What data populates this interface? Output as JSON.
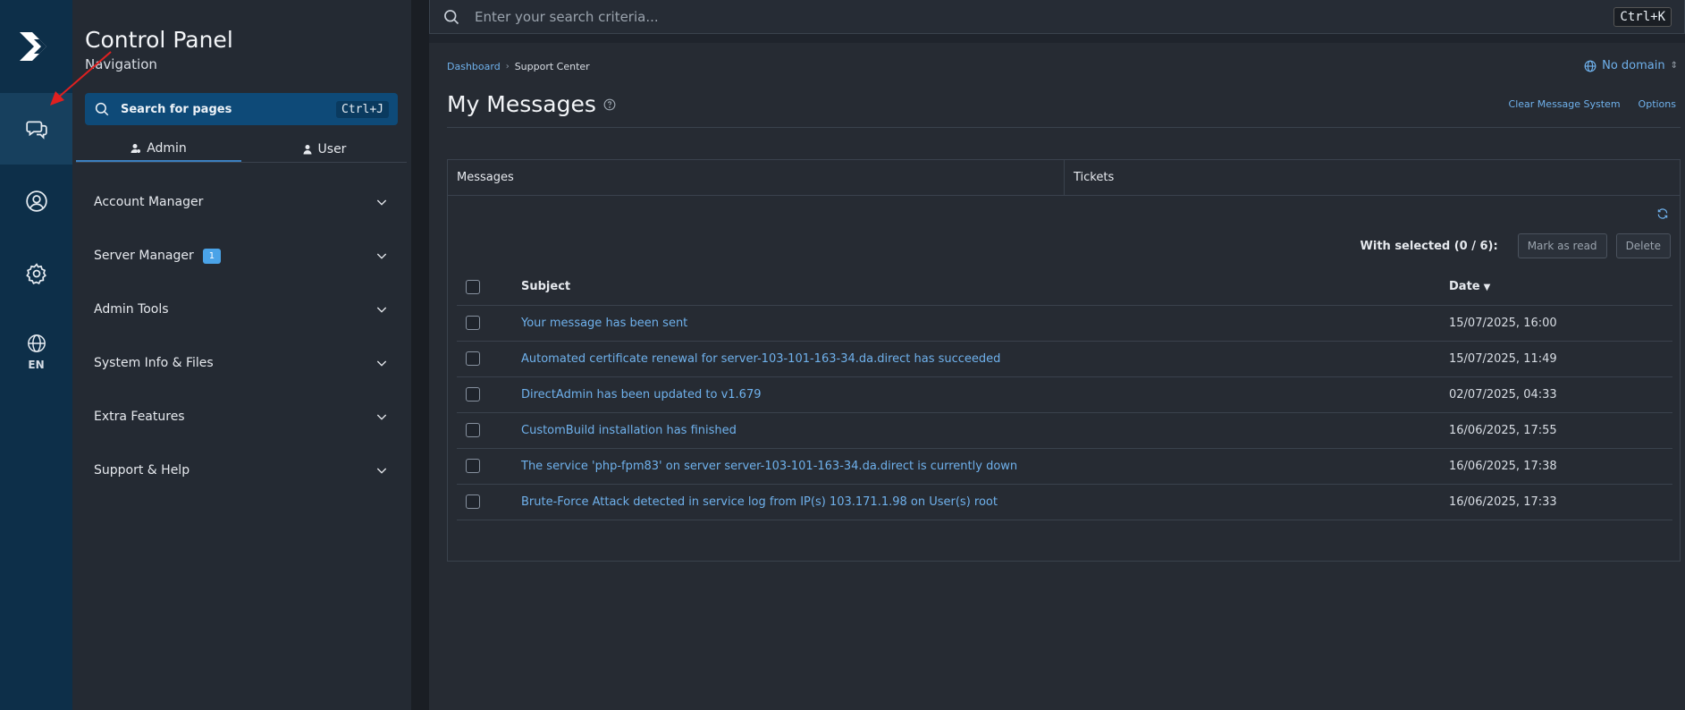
{
  "rail": {
    "lang": "EN"
  },
  "nav": {
    "title": "Control Panel",
    "subtitle": "Navigation",
    "search_label": "Search for pages",
    "search_shortcut": "Ctrl+J",
    "tabs": [
      {
        "label": "Admin"
      },
      {
        "label": "User"
      }
    ],
    "items": [
      {
        "label": "Account Manager"
      },
      {
        "label": "Server Manager",
        "badge": "1"
      },
      {
        "label": "Admin Tools"
      },
      {
        "label": "System Info & Files"
      },
      {
        "label": "Extra Features"
      },
      {
        "label": "Support & Help"
      }
    ]
  },
  "topbar": {
    "placeholder": "Enter your search criteria...",
    "shortcut": "Ctrl+K"
  },
  "main": {
    "breadcrumb": [
      "Dashboard",
      "Support Center"
    ],
    "domain": "No domain",
    "title": "My Messages",
    "actions": [
      "Clear Message System",
      "Options"
    ],
    "tabs": [
      "Messages",
      "Tickets"
    ],
    "with_selected": "With selected (0 / 6):",
    "mark_read": "Mark as read",
    "delete": "Delete",
    "columns": {
      "subject": "Subject",
      "date": "Date"
    },
    "rows": [
      {
        "subject": "Your message has been sent",
        "date": "15/07/2025, 16:00"
      },
      {
        "subject": "Automated certificate renewal for server-103-101-163-34.da.direct has succeeded",
        "date": "15/07/2025, 11:49"
      },
      {
        "subject": "DirectAdmin has been updated to v1.679",
        "date": "02/07/2025, 04:33"
      },
      {
        "subject": "CustomBuild installation has finished",
        "date": "16/06/2025, 17:55"
      },
      {
        "subject": "The service 'php-fpm83' on server server-103-101-163-34.da.direct is currently down",
        "date": "16/06/2025, 17:38"
      },
      {
        "subject": "Brute-Force Attack detected in service log from IP(s) 103.171.1.98 on User(s) root",
        "date": "16/06/2025, 17:33"
      }
    ]
  },
  "colors": {
    "rail_bg": "#0d2f49",
    "nav_bg": "#242a33",
    "accent": "#6fb1ec",
    "badge": "#4aa3e8",
    "annotation_arrow": "#e02020"
  }
}
